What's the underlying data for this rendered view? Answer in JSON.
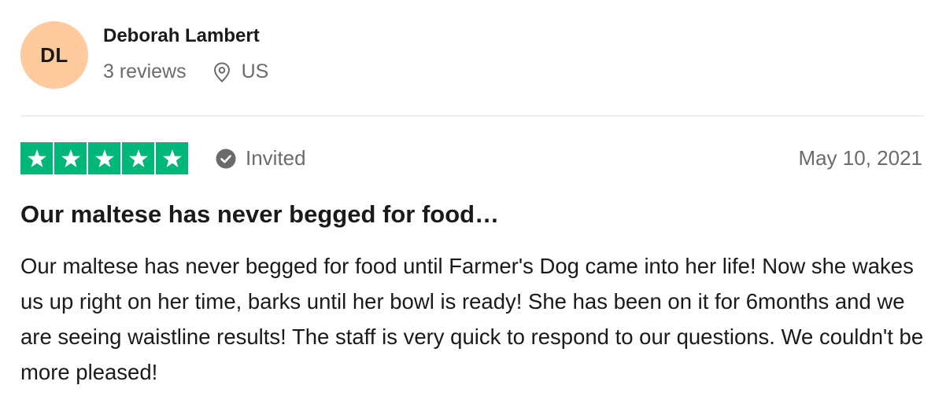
{
  "reviewer": {
    "initials": "DL",
    "avatar_color": "#ffcb9e",
    "name": "Deborah Lambert",
    "review_count": "3 reviews",
    "location_icon": "location-pin-icon",
    "country": "US"
  },
  "review": {
    "rating": 5,
    "rating_max": 5,
    "star_color": "#00b67a",
    "invited_icon": "check-circle-icon",
    "invited_label": "Invited",
    "date": "May 10, 2021",
    "title": "Our maltese has never begged for food…",
    "body": "Our maltese has never begged for food until Farmer's Dog came into her life! Now she wakes us up right on her time, barks until her bowl is ready! She has been on it for 6months and we are seeing waistline results! The staff is very quick to respond to our questions. We couldn't be more pleased!"
  }
}
